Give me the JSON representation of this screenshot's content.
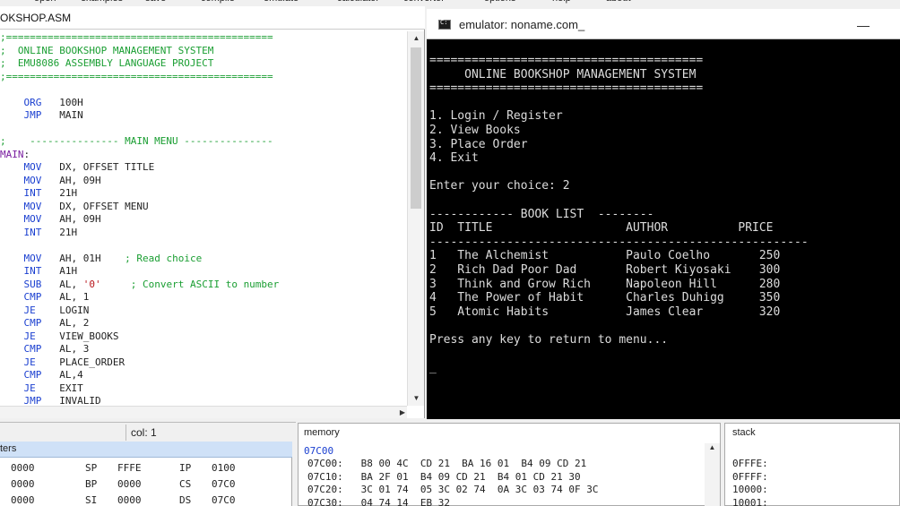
{
  "menu": [
    "open",
    "examples",
    "save",
    "compile",
    "emulate",
    "calculator",
    "convertor",
    "options",
    "help",
    "about"
  ],
  "editor": {
    "title": "OKSHOP.ASM",
    "lines": [
      [
        [
          "c",
          ";============================================="
        ]
      ],
      [
        [
          "c",
          ";  ONLINE BOOKSHOP MANAGEMENT SYSTEM"
        ]
      ],
      [
        [
          "c",
          ";  EMU8086 ASSEMBLY LANGUAGE PROJECT"
        ]
      ],
      [
        [
          "c",
          ";============================================="
        ]
      ],
      [],
      [
        [
          "t",
          "    "
        ],
        [
          "k",
          "ORG"
        ],
        [
          "t",
          "   100H"
        ]
      ],
      [
        [
          "t",
          "    "
        ],
        [
          "k",
          "JMP"
        ],
        [
          "t",
          "   MAIN"
        ]
      ],
      [],
      [
        [
          "c",
          ";    --------------- MAIN MENU ---------------"
        ]
      ],
      [
        [
          "l",
          "MAIN"
        ],
        [
          "t",
          ":"
        ]
      ],
      [
        [
          "t",
          "    "
        ],
        [
          "k",
          "MOV"
        ],
        [
          "t",
          "   DX, OFFSET TITLE"
        ]
      ],
      [
        [
          "t",
          "    "
        ],
        [
          "k",
          "MOV"
        ],
        [
          "t",
          "   AH, 09H"
        ]
      ],
      [
        [
          "t",
          "    "
        ],
        [
          "k",
          "INT"
        ],
        [
          "t",
          "   21H"
        ]
      ],
      [
        [
          "t",
          "    "
        ],
        [
          "k",
          "MOV"
        ],
        [
          "t",
          "   DX, OFFSET MENU"
        ]
      ],
      [
        [
          "t",
          "    "
        ],
        [
          "k",
          "MOV"
        ],
        [
          "t",
          "   AH, 09H"
        ]
      ],
      [
        [
          "t",
          "    "
        ],
        [
          "k",
          "INT"
        ],
        [
          "t",
          "   21H"
        ]
      ],
      [],
      [
        [
          "t",
          "    "
        ],
        [
          "k",
          "MOV"
        ],
        [
          "t",
          "   AH, 01H    "
        ],
        [
          "c",
          "; Read choice"
        ]
      ],
      [
        [
          "t",
          "    "
        ],
        [
          "k",
          "INT"
        ],
        [
          "t",
          "   A1H"
        ]
      ],
      [
        [
          "t",
          "    "
        ],
        [
          "k",
          "SUB"
        ],
        [
          "t",
          "   AL, "
        ],
        [
          "s",
          "'0'"
        ],
        [
          "t",
          "     "
        ],
        [
          "c",
          "; Convert ASCII to number"
        ]
      ],
      [
        [
          "t",
          "    "
        ],
        [
          "k",
          "CMP"
        ],
        [
          "t",
          "   AL, 1"
        ]
      ],
      [
        [
          "t",
          "    "
        ],
        [
          "k",
          "JE"
        ],
        [
          "t",
          "    LOGIN"
        ]
      ],
      [
        [
          "t",
          "    "
        ],
        [
          "k",
          "CMP"
        ],
        [
          "t",
          "   AL, 2"
        ]
      ],
      [
        [
          "t",
          "    "
        ],
        [
          "k",
          "JE"
        ],
        [
          "t",
          "    VIEW_BOOKS"
        ]
      ],
      [
        [
          "t",
          "    "
        ],
        [
          "k",
          "CMP"
        ],
        [
          "t",
          "   AL, 3"
        ]
      ],
      [
        [
          "t",
          "    "
        ],
        [
          "k",
          "JE"
        ],
        [
          "t",
          "    PLACE_ORDER"
        ]
      ],
      [
        [
          "t",
          "    "
        ],
        [
          "k",
          "CMP"
        ],
        [
          "t",
          "   AL,4"
        ]
      ],
      [
        [
          "t",
          "    "
        ],
        [
          "k",
          "JE"
        ],
        [
          "t",
          "    EXIT"
        ]
      ],
      [
        [
          "t",
          "    "
        ],
        [
          "k",
          "JMP"
        ],
        [
          "t",
          "   INVALID"
        ]
      ]
    ]
  },
  "emulator": {
    "title": "emulator: noname.com_",
    "lines": [
      "=======================================",
      "     ONLINE BOOKSHOP MANAGEMENT SYSTEM",
      "=======================================",
      "",
      "1. Login / Register",
      "2. View Books",
      "3. Place Order",
      "4. Exit",
      "",
      "Enter your choice: 2",
      "",
      "------------ BOOK LIST  --------",
      "ID  TITLE                   AUTHOR          PRICE",
      "------------------------------------------------------",
      "1   The Alchemist           Paulo Coelho       250",
      "2   Rich Dad Poor Dad       Robert Kiyosaki    300",
      "3   Think and Grow Rich     Napoleon Hill      280",
      "4   The Power of Habit      Charles Duhigg     350",
      "5   Atomic Habits           James Clear        320",
      "",
      "Press any key to return to menu...",
      "",
      "_"
    ]
  },
  "status": {
    "col": "col: 1"
  },
  "registers": {
    "header": "ters",
    "rows": [
      [
        "0000",
        "SP",
        "FFFE",
        "IP",
        "0100"
      ],
      [
        "0000",
        "BP",
        "0000",
        "CS",
        "07C0"
      ],
      [
        "0000",
        "SI",
        "0000",
        "DS",
        "07C0"
      ]
    ]
  },
  "memory": {
    "title": "memory",
    "address": "07C00",
    "rows": [
      "07C00:   B8 00 4C  CD 21  BA 16 01  B4 09 CD 21",
      "07C10:   BA 2F 01  B4 09 CD 21  B4 01 CD 21 30",
      "07C20:   3C 01 74  05 3C 02 74  0A 3C 03 74 0F 3C",
      "07C30:   04 74 14  EB 32"
    ]
  },
  "stack": {
    "title": "stack",
    "rows": [
      "0FFFE:",
      "0FFFF:",
      "10000:",
      "10001:"
    ]
  }
}
